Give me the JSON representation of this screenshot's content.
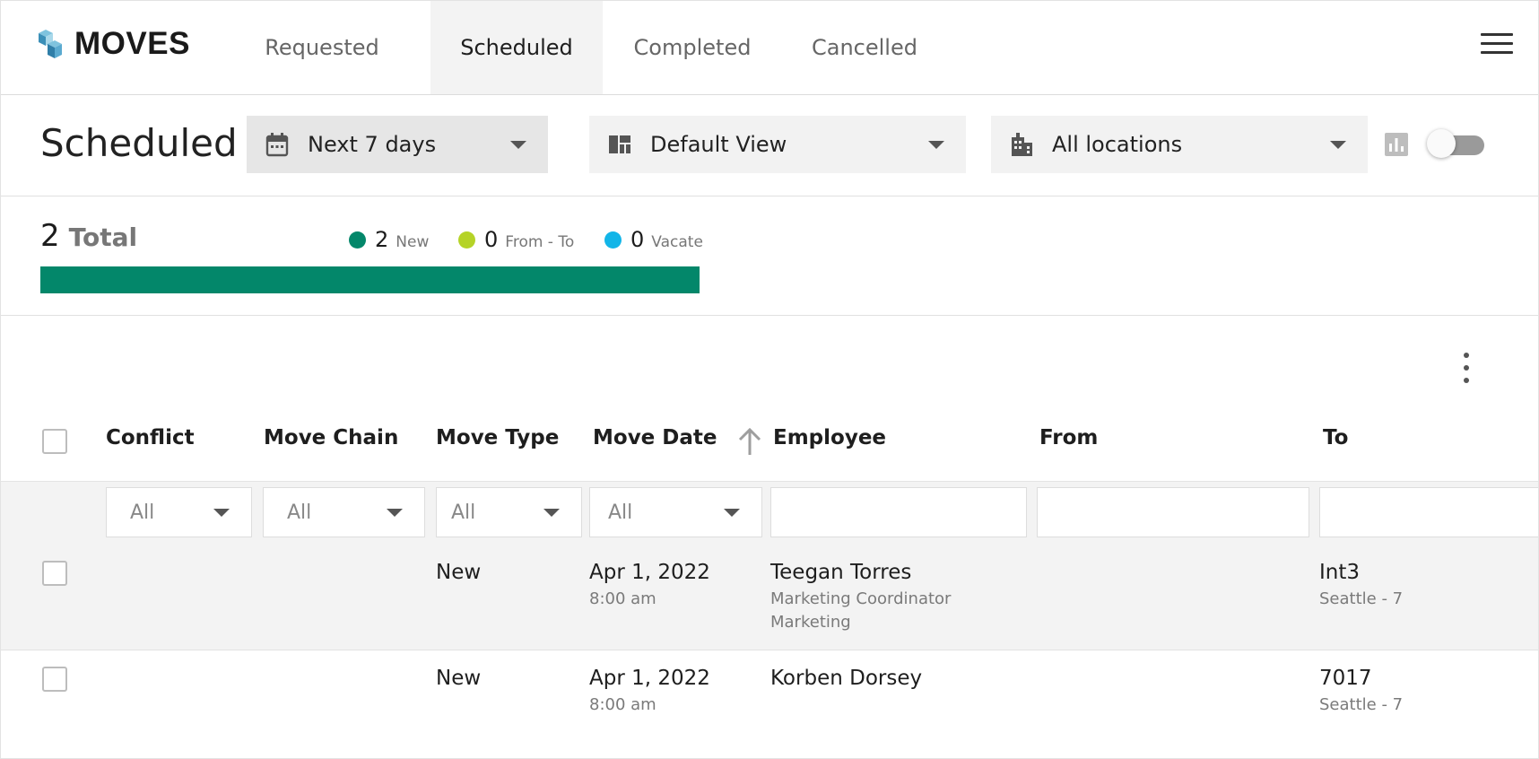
{
  "app": {
    "brand": "MOVES"
  },
  "nav": {
    "tabs": [
      {
        "label": "Requested",
        "active": false
      },
      {
        "label": "Scheduled",
        "active": true
      },
      {
        "label": "Completed",
        "active": false
      },
      {
        "label": "Cancelled",
        "active": false
      }
    ],
    "menu_icon": "hamburger-menu-icon"
  },
  "filters": {
    "title": "Scheduled",
    "date_range": "Next 7 days",
    "view": "Default View",
    "location": "All locations",
    "chart_toggle_on": false
  },
  "summary": {
    "total": "2",
    "total_label": "Total",
    "legend": [
      {
        "count": "2",
        "label": "New",
        "color": "#03876a"
      },
      {
        "count": "0",
        "label": "From - To",
        "color": "#b5d327"
      },
      {
        "count": "0",
        "label": "Vacate",
        "color": "#12b5e8"
      }
    ],
    "progress_new_fraction": 1.0,
    "progress_color": "#03876a"
  },
  "table": {
    "columns": [
      "Conflict",
      "Move Chain",
      "Move Type",
      "Move Date",
      "Employee",
      "From",
      "To"
    ],
    "sort": {
      "column": "Move Date",
      "direction": "ascending"
    },
    "column_filters": {
      "conflict": "All",
      "move_chain": "All",
      "move_type": "All",
      "move_date": "All",
      "employee": "",
      "from": "",
      "to": ""
    },
    "rows": [
      {
        "conflict": "",
        "move_chain": "",
        "move_type": "New",
        "move_date": "Apr 1, 2022",
        "move_time": "8:00 am",
        "employee": "Teegan Torres",
        "employee_title": "Marketing Coordinator",
        "employee_dept": "Marketing",
        "from": "",
        "to": "Int3",
        "to_sub": "Seattle - 7"
      },
      {
        "conflict": "",
        "move_chain": "",
        "move_type": "New",
        "move_date": "Apr 1, 2022",
        "move_time": "8:00 am",
        "employee": "Korben Dorsey",
        "employee_title": "",
        "employee_dept": "",
        "from": "",
        "to": "7017",
        "to_sub": "Seattle - 7"
      }
    ]
  }
}
